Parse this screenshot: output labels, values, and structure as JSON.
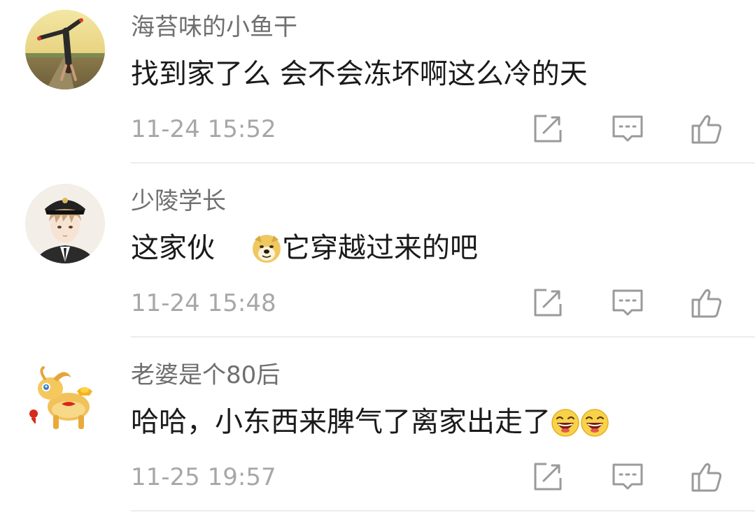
{
  "comments": [
    {
      "username": "海苔味的小鱼干",
      "text": "找到家了么 会不会冻坏啊这么冷的天",
      "timestamp": "11-24 15:52",
      "avatar": "handstand-photo-avatar"
    },
    {
      "username": "少陵学长",
      "text_before": "这家伙",
      "emoji": "doge-emoji",
      "text_after": "它穿越过来的吧",
      "timestamp": "11-24 15:48",
      "avatar": "anime-boy-captain-hat-avatar"
    },
    {
      "username": "老婆是个80后",
      "text": "哈哈，小东西来脾气了离家出走了",
      "emoji": "laughing-emoji",
      "emoji_count": 2,
      "timestamp": "11-25 19:57",
      "avatar": "golden-goat-avatar"
    }
  ],
  "actions": {
    "icons": [
      "forward-icon",
      "comment-icon",
      "like-icon"
    ]
  },
  "colors": {
    "username": "#6f6f6f",
    "text": "#1a1a1a",
    "timestamp": "#a7a7a7",
    "icon": "#9a9a9a",
    "divider": "#ececec"
  }
}
